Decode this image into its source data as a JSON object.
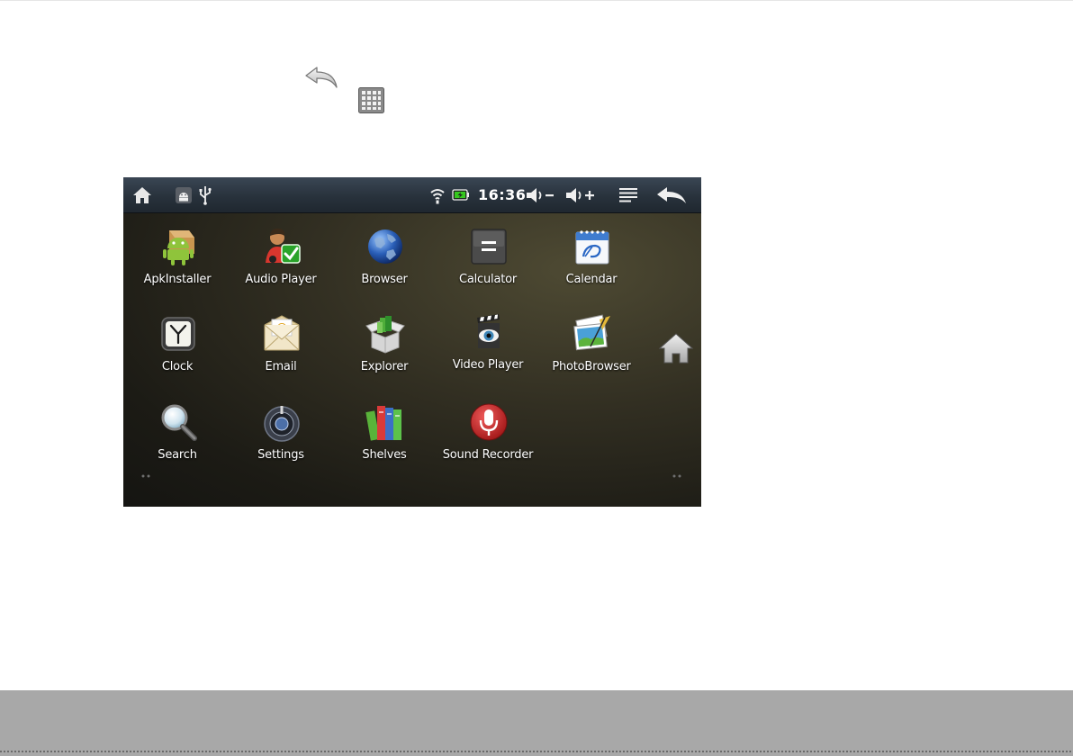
{
  "status_bar": {
    "time": "16:36",
    "icons": {
      "home": "home-icon",
      "android": "android-debug-icon",
      "usb": "usb-icon",
      "wifi": "wifi-icon",
      "battery": "battery-icon",
      "volume_down": "volume-down-icon",
      "volume_up": "volume-up-icon",
      "menu": "menu-icon",
      "back": "back-icon"
    }
  },
  "apps": [
    {
      "label": "ApkInstaller",
      "icon": "apk-installer-icon"
    },
    {
      "label": "Audio Player",
      "icon": "audio-player-icon"
    },
    {
      "label": "Browser",
      "icon": "browser-globe-icon"
    },
    {
      "label": "Calculator",
      "icon": "calculator-icon"
    },
    {
      "label": "Calendar",
      "icon": "calendar-icon"
    },
    {
      "label": "Clock",
      "icon": "clock-icon"
    },
    {
      "label": "Email",
      "icon": "email-icon"
    },
    {
      "label": "Explorer",
      "icon": "explorer-icon"
    },
    {
      "label": "Video Player",
      "icon": "video-player-icon"
    },
    {
      "label": "PhotoBrowser",
      "icon": "photo-browser-icon"
    },
    {
      "label": "Search",
      "icon": "search-icon"
    },
    {
      "label": "Settings",
      "icon": "settings-icon"
    },
    {
      "label": "Shelves",
      "icon": "shelves-icon"
    },
    {
      "label": "Sound Recorder",
      "icon": "sound-recorder-icon"
    }
  ],
  "page_icons": {
    "back": "back-arrow-icon",
    "app_drawer": "app-drawer-grid-icon"
  },
  "colors": {
    "status_bar": "#28323c",
    "desktop_background": "#2a281d",
    "footer_band": "#a8a8a8"
  }
}
